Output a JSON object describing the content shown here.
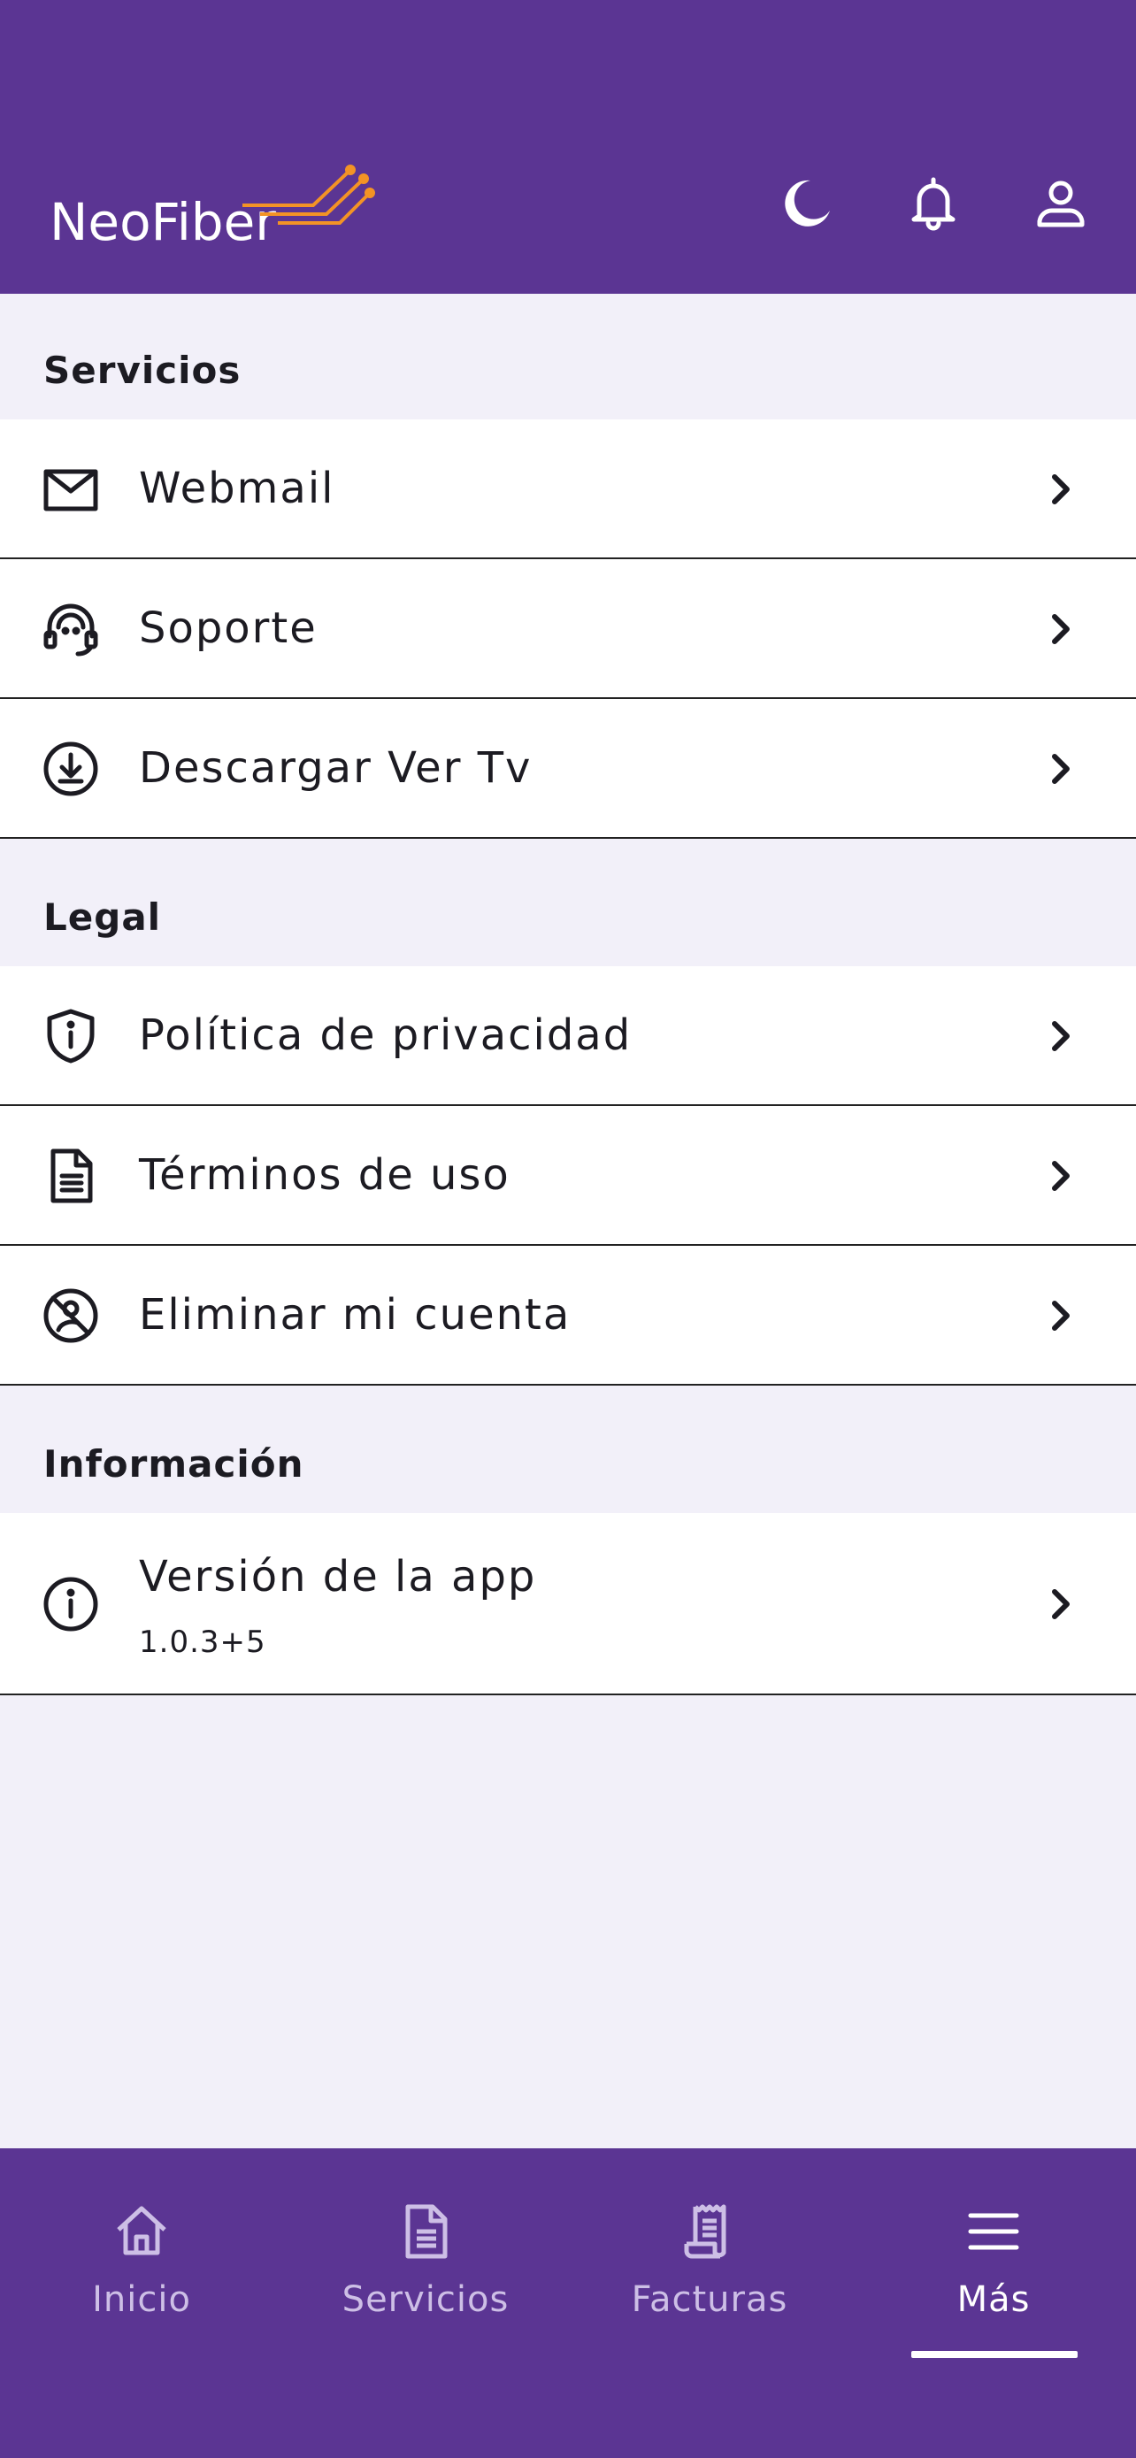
{
  "app": {
    "brand": "NeoFiber",
    "brand_color": "#5B3593",
    "accent_color": "#F39325"
  },
  "header": {
    "icons": [
      "moon-icon",
      "bell-icon",
      "user-icon"
    ]
  },
  "sections": {
    "servicios": {
      "title": "Servicios",
      "items": [
        {
          "label": "Webmail",
          "icon": "mail-icon"
        },
        {
          "label": "Soporte",
          "icon": "headset-icon"
        },
        {
          "label": "Descargar Ver Tv",
          "icon": "download-icon"
        }
      ]
    },
    "legal": {
      "title": "Legal",
      "items": [
        {
          "label": "Política de privacidad",
          "icon": "shield-icon"
        },
        {
          "label": "Términos de uso",
          "icon": "document-icon"
        },
        {
          "label": "Eliminar mi cuenta",
          "icon": "no-account-icon"
        }
      ]
    },
    "informacion": {
      "title": "Información",
      "items": [
        {
          "label": "Versión de la app",
          "sublabel": "1.0.3+5",
          "icon": "info-icon"
        }
      ]
    }
  },
  "bottom_nav": {
    "items": [
      {
        "label": "Inicio",
        "icon": "home-icon"
      },
      {
        "label": "Servicios",
        "icon": "document-icon"
      },
      {
        "label": "Facturas",
        "icon": "receipt-icon"
      },
      {
        "label": "Más",
        "icon": "menu-icon"
      }
    ],
    "active_index": 3
  }
}
